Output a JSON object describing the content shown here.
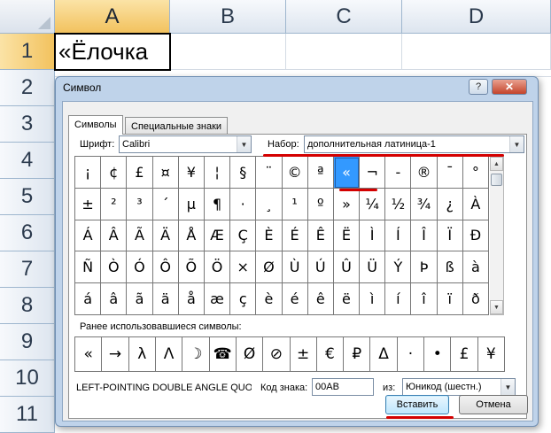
{
  "sheet": {
    "columns": [
      "A",
      "B",
      "C",
      "D"
    ],
    "rows": [
      "1",
      "2",
      "3",
      "4",
      "5",
      "6",
      "7",
      "8",
      "9",
      "10",
      "11"
    ],
    "cell_a1": "«Ёлочка"
  },
  "dialog": {
    "title": "Символ",
    "help_label": "?",
    "close_label": "✕",
    "tabs": [
      "Символы",
      "Специальные знаки"
    ],
    "font_label": "Шрифт:",
    "font_value": "Calibri",
    "subset_label": "Набор:",
    "subset_value": "дополнительная латиница-1",
    "symbols": [
      [
        "¡",
        "¢",
        "£",
        "¤",
        "¥",
        "¦",
        "§",
        "¨",
        "©",
        "ª",
        "«",
        "¬",
        "-",
        "®",
        "¯",
        "°"
      ],
      [
        "±",
        "²",
        "³",
        "´",
        "µ",
        "¶",
        "·",
        "¸",
        "¹",
        "º",
        "»",
        "¼",
        "½",
        "¾",
        "¿",
        "À"
      ],
      [
        "Á",
        "Â",
        "Ã",
        "Ä",
        "Å",
        "Æ",
        "Ç",
        "È",
        "É",
        "Ê",
        "Ë",
        "Ì",
        "Í",
        "Î",
        "Ï",
        "Ð"
      ],
      [
        "Ñ",
        "Ò",
        "Ó",
        "Ô",
        "Õ",
        "Ö",
        "×",
        "Ø",
        "Ù",
        "Ú",
        "Û",
        "Ü",
        "Ý",
        "Þ",
        "ß",
        "à"
      ],
      [
        "á",
        "â",
        "ã",
        "ä",
        "å",
        "æ",
        "ç",
        "è",
        "é",
        "ê",
        "ë",
        "ì",
        "í",
        "î",
        "ï",
        "ð"
      ]
    ],
    "recent_label": "Ранее использовавшиеся символы:",
    "recent_symbols": [
      "«",
      "→",
      "λ",
      "Λ",
      "☽",
      "☎",
      "Ø",
      "⊘",
      "±",
      "€",
      "₽",
      "Δ",
      "·",
      "•",
      "£",
      "¥"
    ],
    "char_name": "LEFT-POINTING DOUBLE ANGLE QUOT...",
    "code_label": "Код знака:",
    "code_value": "00AB",
    "from_label": "из:",
    "from_value": "Юникод (шестн.)",
    "insert_label": "Вставить",
    "cancel_label": "Отмена"
  },
  "colors": {
    "selection_blue": "#3399ff",
    "highlight_red": "#d40000"
  }
}
